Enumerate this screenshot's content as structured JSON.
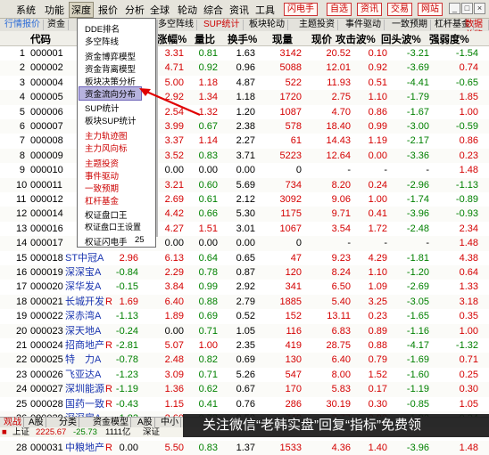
{
  "menubar": {
    "items": [
      "系统",
      "功能",
      "深度",
      "报价",
      "分析",
      "全球",
      "轮动",
      "综合",
      "资讯",
      "工具"
    ],
    "right_buttons": [
      "闪电手",
      "自选",
      "资讯",
      "交易",
      "网站"
    ]
  },
  "subtabs": [
    "行情报价",
    "资金",
    "",
    "多空阵线",
    "SUP统计",
    "板块轮动",
    "主题投资",
    "事件驱动",
    "一致预期",
    "杠杆基金",
    "数据总览"
  ],
  "columns": [
    "代码",
    "涨幅%",
    "量比",
    "换手%",
    "现量",
    "现价",
    "攻击波%",
    "回头波%",
    "强弱度%"
  ],
  "menu": {
    "items": [
      "DDE排名",
      "多空阵线",
      "资金博弈模型",
      "资金背离模型",
      "板块决策分析",
      "资金流向分布",
      "SUP统计",
      "板块SUP统计",
      "主力轨迹图",
      "主力风向标",
      "主题投资",
      "事件驱动",
      "一致预期",
      "杠杆基金",
      "权证盘口王",
      "权证盘口王设置",
      "权证闪电手"
    ],
    "selected": "资金流向分布",
    "flash_value": "25"
  },
  "rows": [
    {
      "no": "1",
      "code": "000001",
      "name": "",
      "flag": "",
      "chg": "",
      "pct": "3.31",
      "vr": "0.81",
      "to": "1.63",
      "vol": "3142",
      "price": "20.52",
      "atk": "0.10",
      "back": "-3.21",
      "str": "-1.54"
    },
    {
      "no": "2",
      "code": "000002",
      "name": "",
      "flag": "",
      "chg": "",
      "pct": "4.71",
      "vr": "0.92",
      "to": "0.96",
      "vol": "5088",
      "price": "12.01",
      "atk": "0.92",
      "back": "-3.69",
      "str": "0.74"
    },
    {
      "no": "3",
      "code": "000004",
      "name": "",
      "flag": "",
      "chg": "",
      "pct": "5.00",
      "vr": "1.18",
      "to": "4.87",
      "vol": "522",
      "price": "11.93",
      "atk": "0.51",
      "back": "-4.41",
      "str": "-0.65"
    },
    {
      "no": "4",
      "code": "000005",
      "name": "",
      "flag": "",
      "chg": "",
      "pct": "2.92",
      "vr": "1.34",
      "to": "1.18",
      "vol": "1720",
      "price": "2.75",
      "atk": "1.10",
      "back": "-1.79",
      "str": "1.85"
    },
    {
      "no": "5",
      "code": "000006",
      "name": "",
      "flag": "",
      "chg": "",
      "pct": "2.54",
      "vr": "1.32",
      "to": "1.20",
      "vol": "1087",
      "price": "4.70",
      "atk": "0.86",
      "back": "-1.67",
      "str": "1.00"
    },
    {
      "no": "6",
      "code": "000007",
      "name": "",
      "flag": "",
      "chg": "",
      "pct": "3.99",
      "vr": "0.67",
      "to": "2.38",
      "vol": "578",
      "price": "18.40",
      "atk": "0.99",
      "back": "-3.00",
      "str": "-0.59"
    },
    {
      "no": "7",
      "code": "000008",
      "name": "",
      "flag": "",
      "chg": "",
      "pct": "3.37",
      "vr": "1.14",
      "to": "2.27",
      "vol": "61",
      "price": "14.43",
      "atk": "1.19",
      "back": "-2.17",
      "str": "0.86"
    },
    {
      "no": "8",
      "code": "000009",
      "name": "",
      "flag": "",
      "chg": "",
      "pct": "3.52",
      "vr": "0.83",
      "to": "3.71",
      "vol": "5223",
      "price": "12.64",
      "atk": "0.00",
      "back": "-3.36",
      "str": "0.23"
    },
    {
      "no": "9",
      "code": "000010",
      "name": "",
      "flag": "",
      "chg": "",
      "pct": "0.00",
      "vr": "0.00",
      "to": "0.00",
      "vol": "0",
      "price": "-",
      "atk": "-",
      "back": "-",
      "str": "1.48"
    },
    {
      "no": "10",
      "code": "000011",
      "name": "",
      "flag": "",
      "chg": "",
      "pct": "3.21",
      "vr": "0.60",
      "to": "5.69",
      "vol": "734",
      "price": "8.20",
      "atk": "0.24",
      "back": "-2.96",
      "str": "-1.13"
    },
    {
      "no": "11",
      "code": "000012",
      "name": "",
      "flag": "",
      "chg": "",
      "pct": "2.69",
      "vr": "0.61",
      "to": "2.12",
      "vol": "3092",
      "price": "9.06",
      "atk": "1.00",
      "back": "-1.74",
      "str": "-0.89"
    },
    {
      "no": "12",
      "code": "000014",
      "name": "",
      "flag": "",
      "chg": "",
      "pct": "4.42",
      "vr": "0.66",
      "to": "5.30",
      "vol": "1175",
      "price": "9.71",
      "atk": "0.41",
      "back": "-3.96",
      "str": "-0.93"
    },
    {
      "no": "13",
      "code": "000016",
      "name": "",
      "flag": "",
      "chg": "",
      "pct": "4.27",
      "vr": "1.51",
      "to": "3.01",
      "vol": "1067",
      "price": "3.54",
      "atk": "1.72",
      "back": "-2.48",
      "str": "2.34"
    },
    {
      "no": "14",
      "code": "000017",
      "name": "",
      "flag": "",
      "chg": "",
      "pct": "0.00",
      "vr": "0.00",
      "to": "0.00",
      "vol": "0",
      "price": "-",
      "atk": "-",
      "back": "-",
      "str": "1.48"
    },
    {
      "no": "15",
      "code": "000018",
      "name": "ST中冠A",
      "flag": "",
      "chg": "2.96",
      "pct": "6.13",
      "vr": "0.64",
      "to": "0.65",
      "vol": "47",
      "price": "9.23",
      "atk": "4.29",
      "back": "-1.81",
      "str": "4.38"
    },
    {
      "no": "16",
      "code": "000019",
      "name": "深深宝A",
      "flag": "",
      "chg": "-0.84",
      "pct": "2.29",
      "vr": "0.78",
      "to": "0.87",
      "vol": "120",
      "price": "8.24",
      "atk": "1.10",
      "back": "-1.20",
      "str": "0.64"
    },
    {
      "no": "17",
      "code": "000020",
      "name": "深华发A",
      "flag": "",
      "chg": "-0.15",
      "pct": "3.84",
      "vr": "0.99",
      "to": "2.92",
      "vol": "341",
      "price": "6.50",
      "atk": "1.09",
      "back": "-2.69",
      "str": "1.33"
    },
    {
      "no": "18",
      "code": "000021",
      "name": "长城开发",
      "flag": "R",
      "chg": "1.69",
      "pct": "6.40",
      "vr": "0.88",
      "to": "2.79",
      "vol": "1885",
      "price": "5.40",
      "atk": "3.25",
      "back": "-3.05",
      "str": "3.18"
    },
    {
      "no": "19",
      "code": "000022",
      "name": "深赤湾A",
      "flag": "",
      "chg": "-1.13",
      "pct": "1.89",
      "vr": "0.69",
      "to": "0.52",
      "vol": "152",
      "price": "13.11",
      "atk": "0.23",
      "back": "-1.65",
      "str": "0.35"
    },
    {
      "no": "20",
      "code": "000023",
      "name": "深天地A",
      "flag": "",
      "chg": "-0.24",
      "pct": "0.00",
      "vr": "0.71",
      "to": "1.05",
      "vol": "116",
      "price": "6.83",
      "atk": "0.89",
      "back": "-1.16",
      "str": "1.00"
    },
    {
      "no": "21",
      "code": "000024",
      "name": "招商地产",
      "flag": "R",
      "chg": "-2.81",
      "pct": "5.07",
      "vr": "1.00",
      "to": "2.35",
      "vol": "419",
      "price": "28.75",
      "atk": "0.88",
      "back": "-4.17",
      "str": "-1.32"
    },
    {
      "no": "22",
      "code": "000025",
      "name": "特　力A",
      "flag": "",
      "chg": "-0.78",
      "pct": "2.48",
      "vr": "0.82",
      "to": "0.69",
      "vol": "130",
      "price": "6.40",
      "atk": "0.79",
      "back": "-1.69",
      "str": "0.71"
    },
    {
      "no": "23",
      "code": "000026",
      "name": "飞亚达A",
      "flag": "",
      "chg": "-1.23",
      "pct": "3.09",
      "vr": "0.71",
      "to": "5.26",
      "vol": "547",
      "price": "8.00",
      "atk": "1.52",
      "back": "-1.60",
      "str": "0.25"
    },
    {
      "no": "24",
      "code": "000027",
      "name": "深圳能源",
      "flag": "R",
      "chg": "-1.19",
      "pct": "1.36",
      "vr": "0.62",
      "to": "0.67",
      "vol": "170",
      "price": "5.83",
      "atk": "0.17",
      "back": "-1.19",
      "str": "0.30"
    },
    {
      "no": "25",
      "code": "000028",
      "name": "国药一致",
      "flag": "R",
      "chg": "-0.43",
      "pct": "1.15",
      "vr": "0.41",
      "to": "0.76",
      "vol": "286",
      "price": "30.19",
      "atk": "0.30",
      "back": "-0.85",
      "str": "1.05"
    },
    {
      "no": "26",
      "code": "000029",
      "name": "深深房A",
      "flag": "",
      "chg": "-1.82",
      "pct": "2.60",
      "vr": "0.73",
      "to": "0.53",
      "vol": "740",
      "price": "3.77",
      "atk": "0.80",
      "back": "-1.82",
      "str": "-0.34"
    },
    {
      "no": "27",
      "code": "000030",
      "name": "富奥股份",
      "flag": "",
      "chg": "-2.21",
      "pct": "2.21",
      "vr": "0.95",
      "to": "2.59",
      "vol": "975",
      "price": "7.98",
      "atk": "0.13",
      "back": "-2.09",
      "str": "-0.72"
    },
    {
      "no": "28",
      "code": "000031",
      "name": "中粮地产",
      "flag": "R",
      "chg": "0.00",
      "pct": "5.50",
      "vr": "0.83",
      "to": "1.37",
      "vol": "1533",
      "price": "4.36",
      "atk": "1.40",
      "back": "-3.96",
      "str": "1.48"
    }
  ],
  "bottom_tabs": [
    "观战",
    "A股",
    "分类",
    "资金模型",
    "A股",
    "中小",
    "创业",
    "B股"
  ],
  "status": {
    "label": "上证",
    "index": "2225.67",
    "change": "-25.73",
    "amount": "1111亿",
    "extra": "深证"
  },
  "overlay_text": "关注微信“老韩实盘”回复“指标”免费领"
}
